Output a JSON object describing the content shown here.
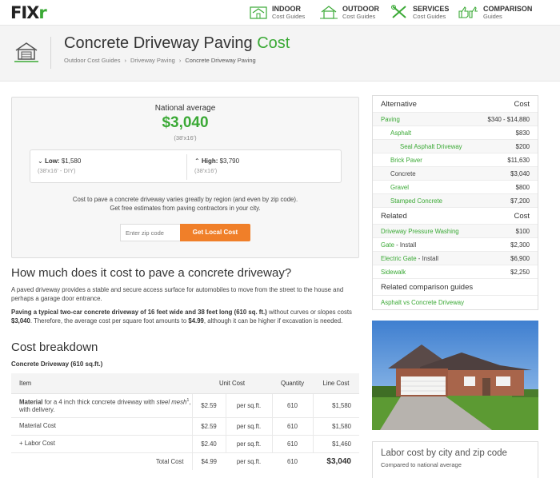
{
  "nav": {
    "logo_text": "FIX",
    "logo_accent": "r",
    "items": [
      {
        "title": "INDOOR",
        "sub": "Cost Guides",
        "icon": "indoor-house-icon"
      },
      {
        "title": "OUTDOOR",
        "sub": "Cost Guides",
        "icon": "outdoor-house-icon"
      },
      {
        "title": "SERVICES",
        "sub": "Cost Guides",
        "icon": "tools-icon"
      },
      {
        "title": "COMPARISON",
        "sub": "Guides",
        "icon": "thumbs-icon"
      }
    ]
  },
  "header": {
    "title_main": "Concrete Driveway Paving ",
    "title_accent": "Cost",
    "breadcrumb": [
      "Outdoor Cost Guides",
      "Driveway Paving",
      "Concrete Driveway Paving"
    ]
  },
  "estimate": {
    "label": "National average",
    "value": "$3,040",
    "dims": "(38'x16')",
    "low_label": "Low:",
    "low_value": " $1,580",
    "low_sub": "(38'x16' - DIY)",
    "high_label": "High:",
    "high_value": " $3,790",
    "high_sub": "(38'x16')",
    "desc_line1": "Cost to pave a concrete driveway varies greatly by region (and even by zip code).",
    "desc_line2": "Get free estimates from paving contractors in your city.",
    "zip_placeholder": "Enter zip code",
    "button": "Get Local Cost"
  },
  "article": {
    "h2": "How much does it cost to pave a concrete driveway?",
    "p1": "A paved driveway provides a stable and secure access surface for automobiles to move from the street to the house and perhaps a garage door entrance.",
    "p2_bold1": "Paving a typical two-car concrete driveway of 16 feet wide and 38 feet long (610 sq. ft.)",
    "p2_mid1": " without curves or slopes costs ",
    "p2_bold2": "$3,040",
    "p2_mid2": ". Therefore, the average cost per square foot amounts to ",
    "p2_bold3": "$4.99",
    "p2_end": ", although it can be higher if excavation is needed.",
    "breakdown_h": "Cost breakdown",
    "breakdown_sub": "Concrete Driveway (610 sq.ft.)"
  },
  "table": {
    "headers": [
      "Item",
      "Unit Cost",
      "Quantity",
      "Line Cost"
    ],
    "row1": {
      "bold": "Material",
      "text": " for a 4 inch thick concrete driveway with ",
      "italic": "steel mesh",
      "sup": "1",
      "tail": ", with delivery.",
      "unit": "$2.59",
      "per": "per sq.ft.",
      "qty": "610",
      "line": "$1,580"
    },
    "row2": {
      "item": "Material Cost",
      "unit": "$2.59",
      "per": "per sq.ft.",
      "qty": "610",
      "line": "$1,580"
    },
    "row3": {
      "item": "+ Labor Cost",
      "unit": "$2.40",
      "per": "per sq.ft.",
      "qty": "610",
      "line": "$1,460"
    },
    "total": {
      "item": "Total Cost",
      "unit": "$4.99",
      "per": "per sq.ft.",
      "qty": "610",
      "line": "$3,040"
    }
  },
  "sidebar": {
    "alt_header": "Alternative",
    "cost_header": "Cost",
    "alternatives": [
      {
        "name": "Paving",
        "cost": "$340 - $14,880",
        "indent": 0,
        "link": true
      },
      {
        "name": "Asphalt",
        "cost": "$830",
        "indent": 1,
        "link": true
      },
      {
        "name": "Seal Asphalt Driveway",
        "cost": "$200",
        "indent": 2,
        "link": true
      },
      {
        "name": "Brick Paver",
        "cost": "$11,630",
        "indent": 1,
        "link": true
      },
      {
        "name": "Concrete",
        "cost": "$3,040",
        "indent": 1,
        "link": false
      },
      {
        "name": "Gravel",
        "cost": "$800",
        "indent": 1,
        "link": true
      },
      {
        "name": "Stamped Concrete",
        "cost": "$7,200",
        "indent": 1,
        "link": true
      }
    ],
    "related_header": "Related",
    "related": [
      {
        "name": "Driveway Pressure Washing",
        "suffix": "",
        "cost": "$100"
      },
      {
        "name": "Gate",
        "suffix": " - Install",
        "cost": "$2,300"
      },
      {
        "name": "Electric Gate",
        "suffix": " - Install",
        "cost": "$6,900"
      },
      {
        "name": "Sidewalk",
        "suffix": "",
        "cost": "$2,250"
      }
    ],
    "comparison_header": "Related comparison guides",
    "comparison": "Asphalt vs Concrete Driveway",
    "labor_title": "Labor cost by city and zip code",
    "labor_sub": "Compared to national average"
  },
  "colors": {
    "brand_green": "#3aa935",
    "cta_orange": "#f07f29"
  }
}
